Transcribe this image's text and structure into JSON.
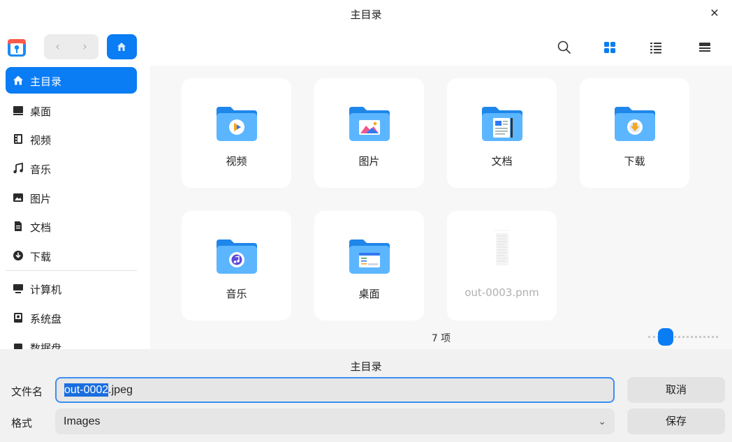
{
  "window": {
    "title": "主目录"
  },
  "toolbar": {
    "back_icon": "chevron-left-icon",
    "forward_icon": "chevron-right-icon",
    "home_icon": "home-icon",
    "search_icon": "search-icon",
    "grid_icon": "grid-view-icon",
    "list_icon": "list-view-icon",
    "detail_icon": "detail-view-icon"
  },
  "sidebar": {
    "items": [
      {
        "label": "主目录",
        "icon": "home-icon",
        "active": true
      },
      {
        "label": "桌面",
        "icon": "desktop-icon"
      },
      {
        "label": "视频",
        "icon": "video-icon"
      },
      {
        "label": "音乐",
        "icon": "music-icon"
      },
      {
        "label": "图片",
        "icon": "picture-icon"
      },
      {
        "label": "文档",
        "icon": "document-icon"
      },
      {
        "label": "下载",
        "icon": "download-icon"
      },
      {
        "label": "计算机",
        "icon": "computer-icon"
      },
      {
        "label": "系统盘",
        "icon": "system-disk-icon"
      },
      {
        "label": "数据盘",
        "icon": "data-disk-icon"
      }
    ]
  },
  "main": {
    "items": [
      {
        "label": "视频",
        "icon": "video-folder-icon"
      },
      {
        "label": "图片",
        "icon": "picture-folder-icon"
      },
      {
        "label": "文档",
        "icon": "document-folder-icon"
      },
      {
        "label": "下载",
        "icon": "download-folder-icon"
      },
      {
        "label": "音乐",
        "icon": "music-folder-icon"
      },
      {
        "label": "桌面",
        "icon": "desktop-folder-icon"
      },
      {
        "label": "out-0003.pnm",
        "icon": "image-file-icon",
        "disabled": true
      }
    ],
    "status": "7 项"
  },
  "dialog": {
    "current_dir": "主目录",
    "filename_label": "文件名",
    "filename_selected": "out-0002",
    "filename_ext": ".jpeg",
    "format_label": "格式",
    "format_value": "Images",
    "cancel_label": "取消",
    "save_label": "保存"
  },
  "colors": {
    "accent": "#0a7cf4",
    "folder_light": "#5cb6ff",
    "folder_dark": "#1f86ea"
  }
}
